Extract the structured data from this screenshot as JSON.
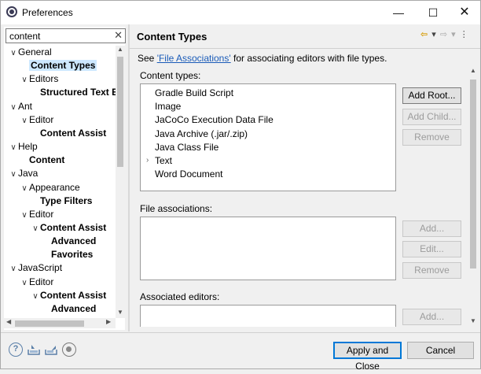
{
  "window": {
    "title": "Preferences",
    "minimize": "—",
    "maximize": "☐",
    "close": "✕"
  },
  "filter": {
    "value": "content",
    "clear": "✕"
  },
  "tree": [
    {
      "label": "General",
      "level": 0,
      "twisty": "∨",
      "bold": false
    },
    {
      "label": "Content Types",
      "level": 1,
      "twisty": "",
      "bold": true,
      "selected": true
    },
    {
      "label": "Editors",
      "level": 1,
      "twisty": "∨",
      "bold": false
    },
    {
      "label": "Structured Text Ed",
      "level": 2,
      "twisty": "",
      "bold": true
    },
    {
      "label": "Ant",
      "level": 0,
      "twisty": "∨",
      "bold": false
    },
    {
      "label": "Editor",
      "level": 1,
      "twisty": "∨",
      "bold": false
    },
    {
      "label": "Content Assist",
      "level": 2,
      "twisty": "",
      "bold": true
    },
    {
      "label": "Help",
      "level": 0,
      "twisty": "∨",
      "bold": false
    },
    {
      "label": "Content",
      "level": 1,
      "twisty": "",
      "bold": true
    },
    {
      "label": "Java",
      "level": 0,
      "twisty": "∨",
      "bold": false
    },
    {
      "label": "Appearance",
      "level": 1,
      "twisty": "∨",
      "bold": false
    },
    {
      "label": "Type Filters",
      "level": 2,
      "twisty": "",
      "bold": true
    },
    {
      "label": "Editor",
      "level": 1,
      "twisty": "∨",
      "bold": false
    },
    {
      "label": "Content Assist",
      "level": 2,
      "twisty": "∨",
      "bold": true
    },
    {
      "label": "Advanced",
      "level": 3,
      "twisty": "",
      "bold": true
    },
    {
      "label": "Favorites",
      "level": 3,
      "twisty": "",
      "bold": true
    },
    {
      "label": "JavaScript",
      "level": 0,
      "twisty": "∨",
      "bold": false
    },
    {
      "label": "Editor",
      "level": 1,
      "twisty": "∨",
      "bold": false
    },
    {
      "label": "Content Assist",
      "level": 2,
      "twisty": "∨",
      "bold": true
    },
    {
      "label": "Advanced",
      "level": 3,
      "twisty": "",
      "bold": true
    }
  ],
  "page": {
    "title": "Content Types",
    "desc_prefix": "See ",
    "desc_link": "'File Associations'",
    "desc_suffix": " for associating editors with file types."
  },
  "content_types": {
    "label": "Content types:",
    "items": [
      {
        "label": "Gradle Build Script",
        "expandable": false
      },
      {
        "label": "Image",
        "expandable": false
      },
      {
        "label": "JaCoCo Execution Data File",
        "expandable": false
      },
      {
        "label": "Java Archive (.jar/.zip)",
        "expandable": false
      },
      {
        "label": "Java Class File",
        "expandable": false
      },
      {
        "label": "Text",
        "expandable": true
      },
      {
        "label": "Word Document",
        "expandable": false
      }
    ],
    "buttons": {
      "add_root": "Add Root...",
      "add_child": "Add Child...",
      "remove": "Remove"
    }
  },
  "file_associations": {
    "label": "File associations:",
    "buttons": {
      "add": "Add...",
      "edit": "Edit...",
      "remove": "Remove"
    }
  },
  "associated_editors": {
    "label": "Associated editors:",
    "buttons": {
      "add": "Add..."
    }
  },
  "footer": {
    "apply_close": "Apply and Close",
    "cancel": "Cancel",
    "help_glyph": "?"
  }
}
